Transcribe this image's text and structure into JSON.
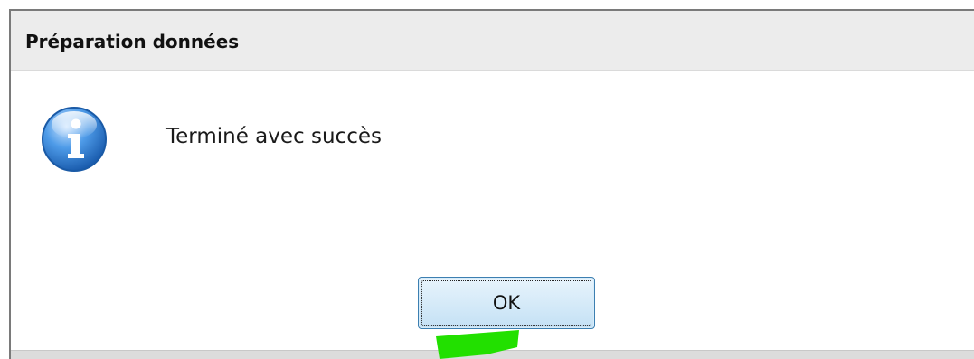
{
  "dialog": {
    "title": "Préparation données",
    "message": "Terminé avec succès",
    "icon": "info-icon",
    "ok_label": "OK"
  },
  "colors": {
    "icon_blue": "#2f7fd6",
    "button_border": "#3c7fb1",
    "marker_green": "#22e000"
  }
}
